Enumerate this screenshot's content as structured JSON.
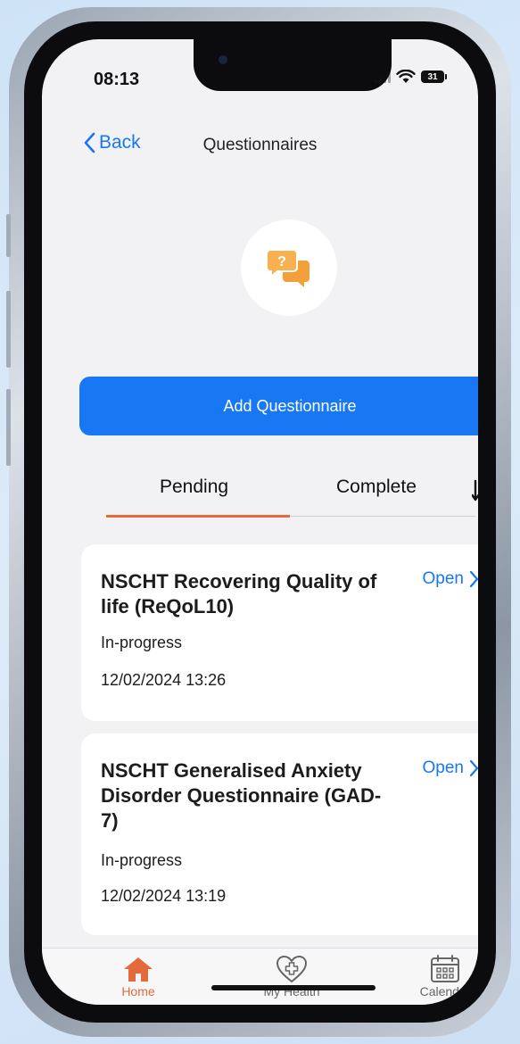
{
  "status": {
    "time": "08:13",
    "battery": "31"
  },
  "nav": {
    "back_label": "Back",
    "title": "Questionnaires"
  },
  "hero": {
    "icon": "chat-question-icon",
    "icon_text": "?"
  },
  "actions": {
    "add_label": "Add Questionnaire"
  },
  "tabs": [
    {
      "label": "Pending",
      "active": true
    },
    {
      "label": "Complete",
      "active": false
    }
  ],
  "questionnaires": [
    {
      "title": "NSCHT Recovering Quality of life (ReQoL10)",
      "status": "In-progress",
      "date": "12/02/2024 13:26",
      "action": "Open"
    },
    {
      "title": "NSCHT Generalised Anxiety Disorder Questionnaire (GAD-7)",
      "status": "In-progress",
      "date": "12/02/2024 13:19",
      "action": "Open"
    }
  ],
  "tabbar": [
    {
      "label": "Home",
      "icon": "home-icon",
      "active": true
    },
    {
      "label": "My Health",
      "icon": "heart-plus-icon",
      "active": false
    },
    {
      "label": "Calendar",
      "icon": "calendar-icon",
      "active": false
    }
  ],
  "colors": {
    "accent": "#1877f2",
    "active_tab": "#e36a3a",
    "hero_icon": "#f4a03a"
  }
}
